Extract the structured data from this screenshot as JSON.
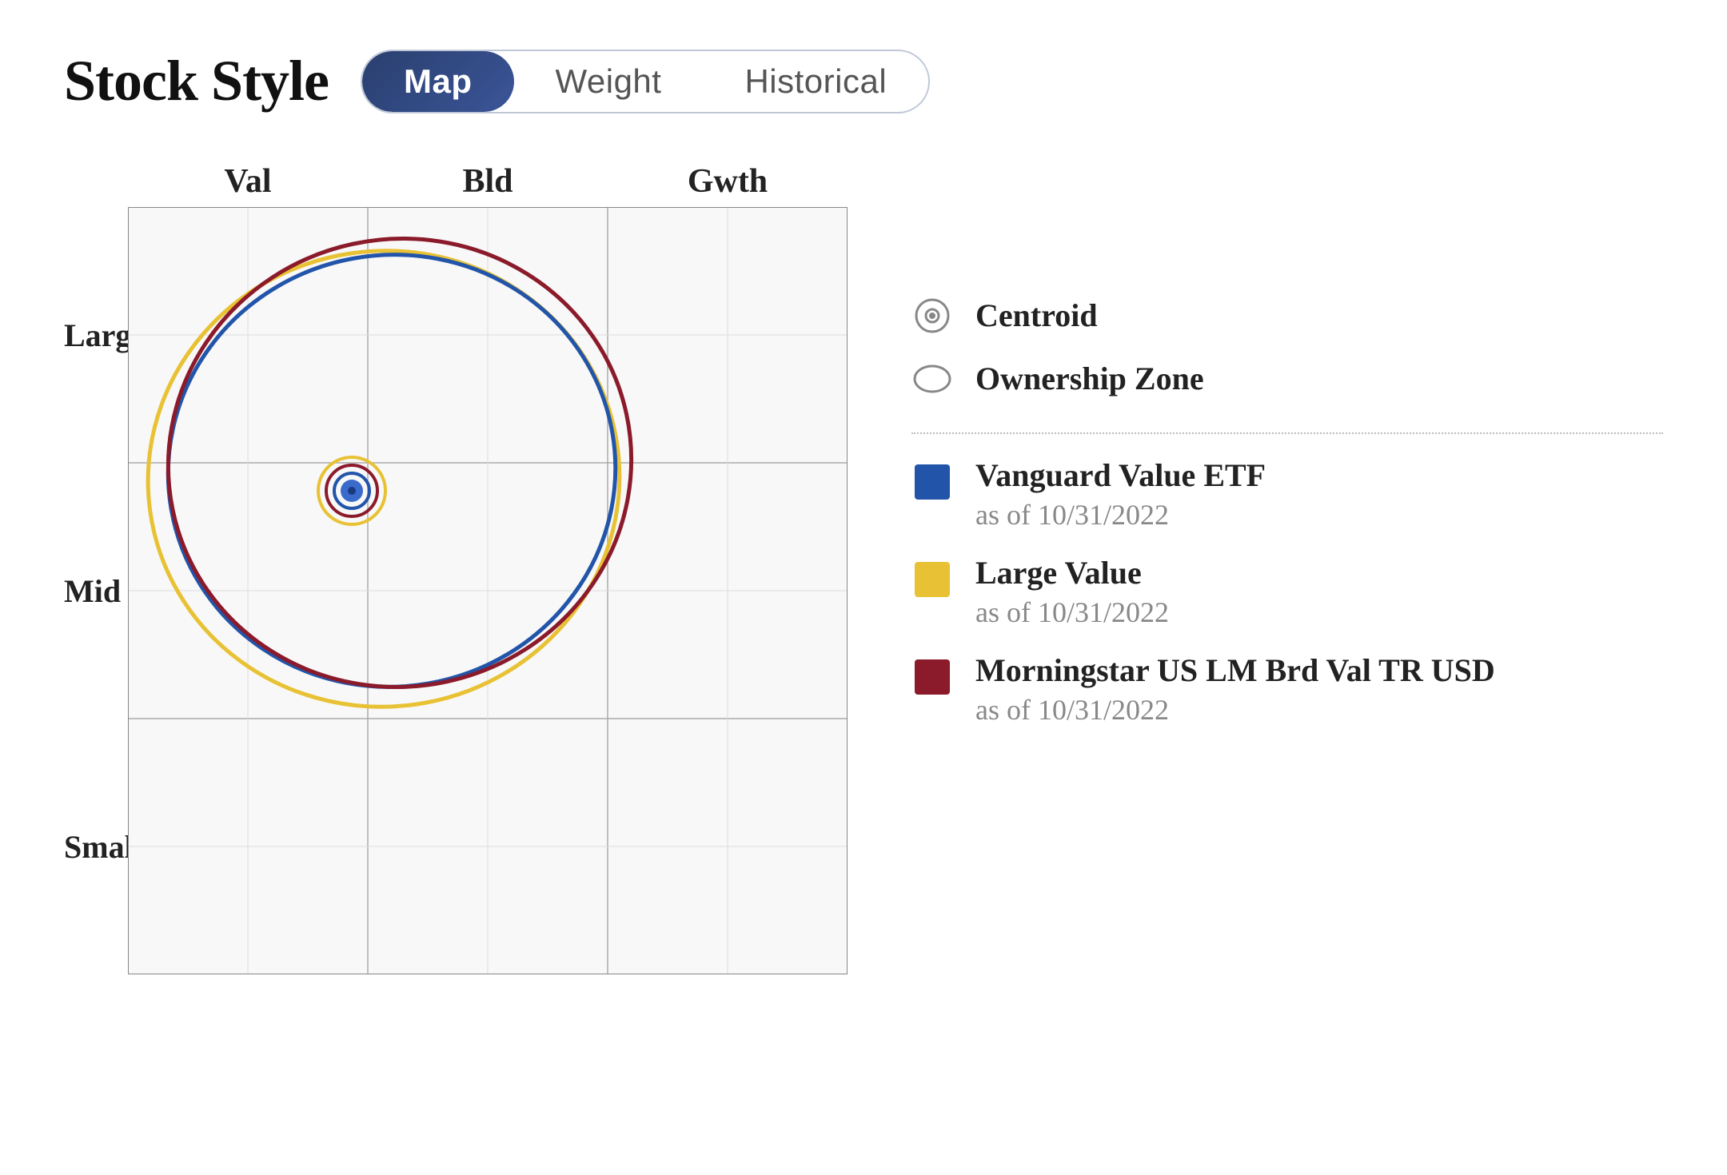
{
  "header": {
    "title": "Stock Style",
    "tabs": [
      {
        "label": "Map",
        "active": true
      },
      {
        "label": "Weight",
        "active": false
      },
      {
        "label": "Historical",
        "active": false
      }
    ]
  },
  "chart": {
    "x_labels": [
      "Val",
      "Bld",
      "Gwth"
    ],
    "y_labels": [
      "Large",
      "Mid",
      "Small"
    ],
    "legend": {
      "centroid_label": "Centroid",
      "ownership_zone_label": "Ownership Zone",
      "items": [
        {
          "name": "Vanguard Value ETF",
          "date": "as of 10/31/2022",
          "color": "#2255aa"
        },
        {
          "name": "Large Value",
          "date": "as of 10/31/2022",
          "color": "#e8c234"
        },
        {
          "name": "Morningstar US LM Brd Val TR USD",
          "date": "as of 10/31/2022",
          "color": "#8b1a2a"
        }
      ]
    }
  }
}
